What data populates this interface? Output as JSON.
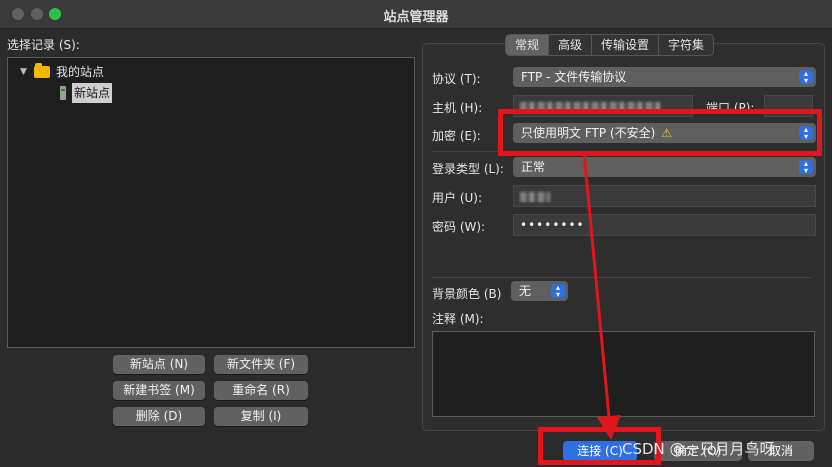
{
  "window": {
    "title": "站点管理器"
  },
  "left": {
    "select_label": "选择记录 (S):",
    "tree": {
      "folder_label": "我的站点",
      "site_label": "新站点"
    },
    "buttons": {
      "new_site": "新站点 (N)",
      "new_folder": "新文件夹 (F)",
      "new_bookmark": "新建书签 (M)",
      "rename": "重命名 (R)",
      "delete": "删除 (D)",
      "copy": "复制 (I)"
    }
  },
  "tabs": [
    "常规",
    "高级",
    "传输设置",
    "字符集"
  ],
  "form": {
    "protocol_label": "协议 (T):",
    "protocol_value": "FTP - 文件传输协议",
    "host_label": "主机 (H):",
    "port_label": "端口 (P):",
    "encryption_label": "加密 (E):",
    "encryption_value": "只使用明文 FTP (不安全)",
    "logon_type_label": "登录类型 (L):",
    "logon_type_value": "正常",
    "user_label": "用户 (U):",
    "password_label": "密码 (W):",
    "password_value": "••••••••",
    "bg_color_label": "背景颜色 (B)",
    "bg_color_value": "无",
    "comments_label": "注释 (M):"
  },
  "bottom": {
    "connect": "连接 (C)",
    "ok": "确定 (O)",
    "cancel": "取消"
  },
  "watermark": "CSDN @一只月月鸟呀",
  "colors": {
    "annotation_red": "#e0161c",
    "accent_blue": "#2f6fe0",
    "folder_yellow": "#f5b700"
  }
}
